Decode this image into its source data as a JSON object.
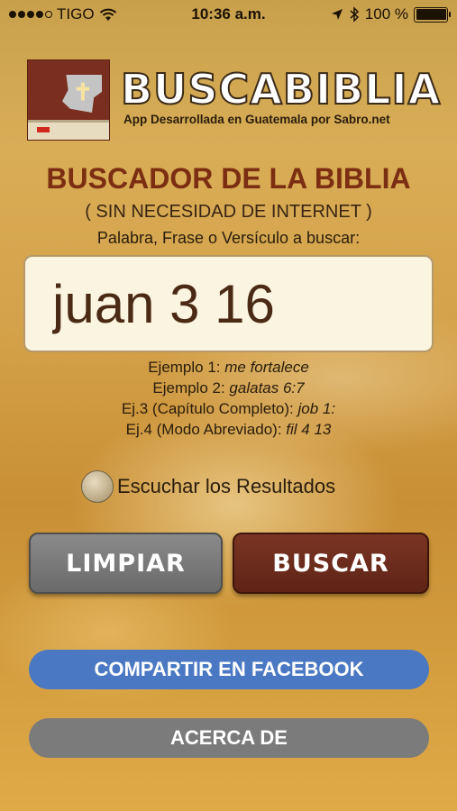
{
  "status_bar": {
    "carrier": "TIGO",
    "time": "10:36 a.m.",
    "battery": "100 %",
    "battery_level": 1.0,
    "icons": [
      "signal-dots-icon",
      "wifi-icon",
      "location-arrow-icon",
      "bluetooth-icon",
      "battery-icon"
    ]
  },
  "header": {
    "app_name": "BUSCABIBLIA",
    "subtitle": "App Desarrollada en Guatemala por Sabro.net"
  },
  "main": {
    "heading": "BUSCADOR DE LA BIBLIA",
    "subheading": "( SIN NECESIDAD DE INTERNET )",
    "search_label": "Palabra, Frase o Versículo a buscar:",
    "search_value": "juan 3 16",
    "examples": [
      {
        "label": "Ejemplo 1: ",
        "value": "me fortalece"
      },
      {
        "label": "Ejemplo 2: ",
        "value": "galatas 6:7"
      },
      {
        "label": "Ej.3 (Capítulo Completo): ",
        "value": "job 1:"
      },
      {
        "label": "Ej.4 (Modo Abreviado): ",
        "value": "fil 4 13"
      }
    ],
    "listen_label": "Escuchar los Resultados"
  },
  "buttons": {
    "clear": "LIMPIAR",
    "search": "BUSCAR",
    "facebook": "COMPARTIR EN FACEBOOK",
    "about": "ACERCA DE"
  },
  "colors": {
    "heading": "#7b2e12",
    "search_button": "#6a2a1a",
    "clear_button": "#7a7a7a",
    "facebook_button": "#4a78c2",
    "about_button": "#7b7b7b"
  }
}
